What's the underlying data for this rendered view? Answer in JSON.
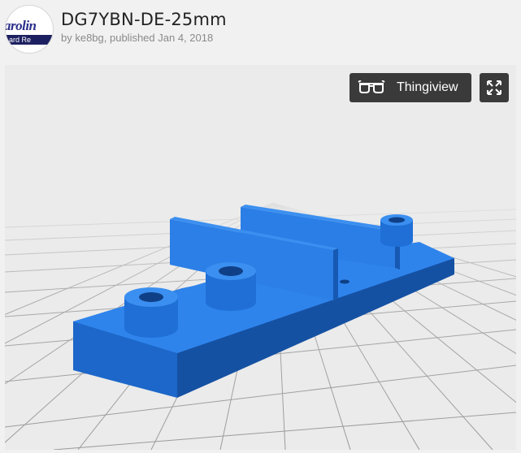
{
  "thing": {
    "title": "DG7YBN-DE-25mm",
    "byline": "by ke8bg, published Jan 4, 2018",
    "avatar_text_top": "arolin",
    "avatar_text_bottom": "ard Re"
  },
  "viewer": {
    "thingiview_label": "Thingiview",
    "icons": {
      "thingiview": "3d-glasses-icon",
      "fullscreen": "expand-arrows-icon"
    },
    "colors": {
      "model": "#1f73d8",
      "grid": "#9a9a9a",
      "background": "#ebebeb"
    }
  }
}
